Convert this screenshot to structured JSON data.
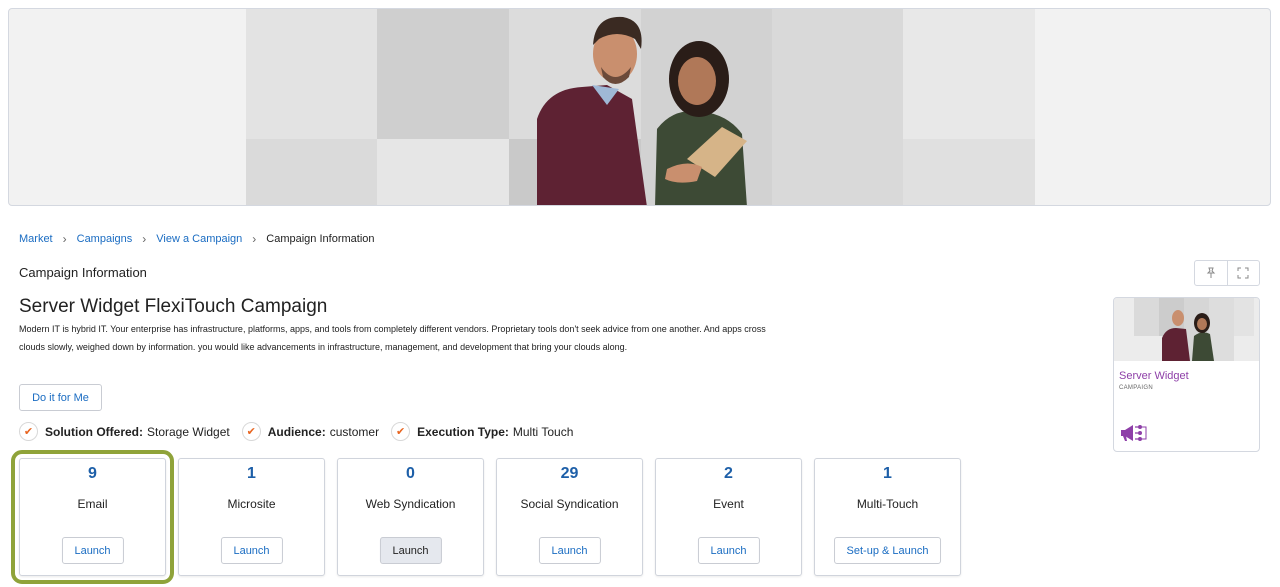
{
  "breadcrumb": {
    "items": [
      "Market",
      "Campaigns",
      "View a Campaign"
    ],
    "current": "Campaign Information"
  },
  "page": {
    "title": "Campaign Information"
  },
  "campaign": {
    "title": "Server Widget FlexiTouch Campaign",
    "description": "Modern IT is hybrid IT. Your enterprise has infrastructure, platforms, apps, and tools from completely different vendors. Proprietary tools don't seek advice from one another. And apps cross clouds slowly, weighed down by information. you would like advancements in infrastructure, management, and development that bring your clouds along.",
    "do_it_label": "Do it for Me"
  },
  "attributes": [
    {
      "key": "Solution Offered:",
      "value": "Storage Widget"
    },
    {
      "key": "Audience:",
      "value": "customer"
    },
    {
      "key": "Execution Type:",
      "value": "Multi Touch"
    }
  ],
  "cards": [
    {
      "count": "9",
      "label": "Email",
      "button": "Launch"
    },
    {
      "count": "1",
      "label": "Microsite",
      "button": "Launch"
    },
    {
      "count": "0",
      "label": "Web Syndication",
      "button": "Launch"
    },
    {
      "count": "29",
      "label": "Social Syndication",
      "button": "Launch"
    },
    {
      "count": "2",
      "label": "Event",
      "button": "Launch"
    },
    {
      "count": "1",
      "label": "Multi-Touch",
      "button": "Set-up & Launch"
    }
  ],
  "preview": {
    "name": "Server Widget",
    "kind": "CAMPAIGN"
  },
  "icons": {
    "pin": "pin-icon",
    "expand": "expand-icon",
    "check": "check-icon",
    "megaphone": "megaphone-icon"
  },
  "colors": {
    "link": "#1a6cc2",
    "count": "#1d5fa8",
    "check": "#e8641f",
    "highlight": "#8fa33a",
    "preview_name": "#8e3fa8"
  }
}
